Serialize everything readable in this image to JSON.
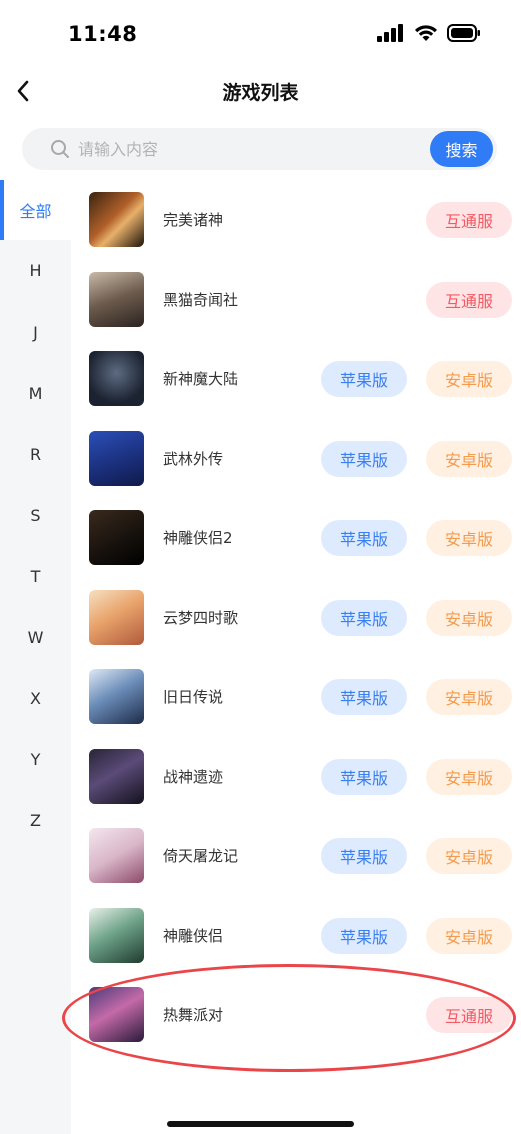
{
  "status_bar": {
    "time": "11:48"
  },
  "nav": {
    "title": "游戏列表"
  },
  "search": {
    "placeholder": "请输入内容",
    "button_label": "搜索"
  },
  "sidebar": {
    "items": [
      {
        "label": "全部",
        "active": true
      },
      {
        "label": "H"
      },
      {
        "label": "J"
      },
      {
        "label": "M"
      },
      {
        "label": "R"
      },
      {
        "label": "S"
      },
      {
        "label": "T"
      },
      {
        "label": "W"
      },
      {
        "label": "X"
      },
      {
        "label": "Y"
      },
      {
        "label": "Z"
      }
    ]
  },
  "games": [
    {
      "name": "完美诸神",
      "buttons": [
        "互通服"
      ],
      "icon": "tiger-game-icon"
    },
    {
      "name": "黑猫奇闻社",
      "buttons": [
        "互通服"
      ],
      "icon": "portrait-game-icon"
    },
    {
      "name": "新神魔大陆",
      "buttons": [
        "苹果版",
        "安卓版"
      ],
      "icon": "logo-game-icon"
    },
    {
      "name": "武林外传",
      "buttons": [
        "苹果版",
        "安卓版"
      ],
      "icon": "logo-game-icon"
    },
    {
      "name": "神雕侠侣2",
      "buttons": [
        "苹果版",
        "安卓版"
      ],
      "icon": "calligraphy-game-icon"
    },
    {
      "name": "云梦四时歌",
      "buttons": [
        "苹果版",
        "安卓版"
      ],
      "icon": "portrait-game-icon"
    },
    {
      "name": "旧日传说",
      "buttons": [
        "苹果版",
        "安卓版"
      ],
      "icon": "portrait-game-icon"
    },
    {
      "name": "战神遗迹",
      "buttons": [
        "苹果版",
        "安卓版"
      ],
      "icon": "portrait-game-icon"
    },
    {
      "name": "倚天屠龙记",
      "buttons": [
        "苹果版",
        "安卓版"
      ],
      "icon": "calligraphy-game-icon"
    },
    {
      "name": "神雕侠侣",
      "buttons": [
        "苹果版",
        "安卓版"
      ],
      "icon": "portrait-game-icon"
    },
    {
      "name": "热舞派对",
      "buttons": [
        "互通服"
      ],
      "icon": "portrait-game-icon"
    }
  ],
  "colors": {
    "accent": "#2f7cf6",
    "apple_pill_bg": "#deebff",
    "android_pill_bg": "#fff0e2",
    "cross_pill_bg": "#ffe4e6",
    "highlight_ring": "#ea4548"
  }
}
